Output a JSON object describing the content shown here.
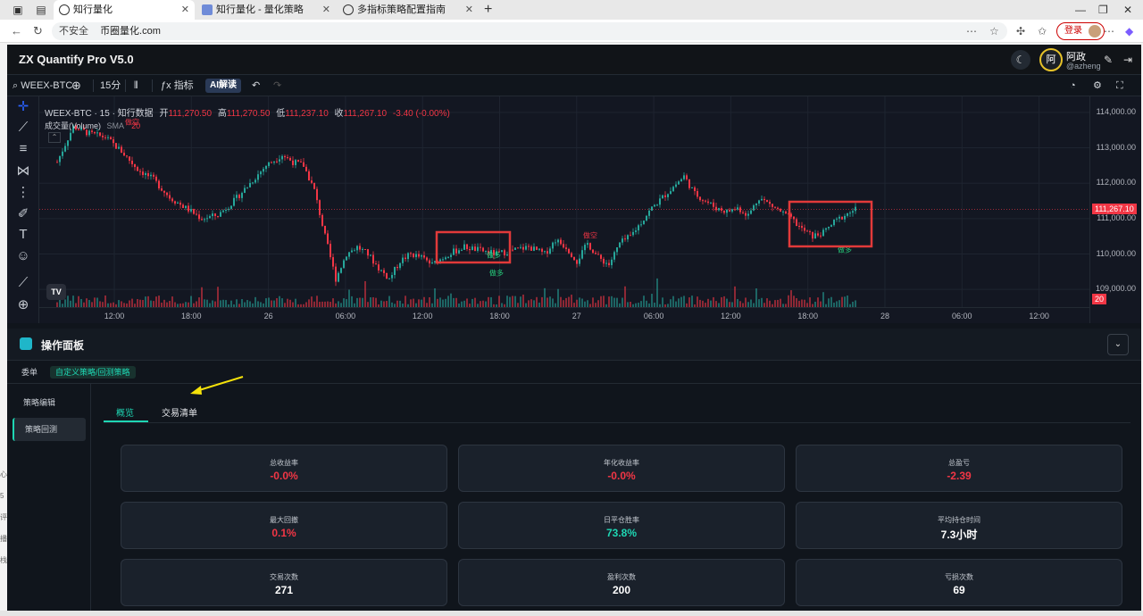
{
  "browser": {
    "tabs": [
      {
        "label": "知行量化",
        "active": true
      },
      {
        "label": "知行量化 - 量化策略",
        "active": false
      },
      {
        "label": "多指标策略配置指南",
        "active": false
      }
    ],
    "address": {
      "insecure_label": "不安全",
      "url": "币圈量化.com"
    },
    "login_label": "登录"
  },
  "app": {
    "title": "ZX Quantify Pro V5.0",
    "user": {
      "avatar_char": "阿",
      "name": "阿政",
      "handle": "@azheng"
    }
  },
  "toolbar": {
    "symbol": "WEEX-BTC",
    "interval": "15分",
    "indicators_label": "指标",
    "ai_label": "AI解读"
  },
  "chart_legend": {
    "title": "WEEX-BTC · 15 · 知行数据",
    "open_label": "开",
    "open": "111,270.50",
    "high_label": "高",
    "high": "111,270.50",
    "low_label": "低",
    "low": "111,237.10",
    "close_label": "收",
    "close": "111,267.10",
    "change": "-3.40 (-0.00%)",
    "volume_label": "成交量(Volume)",
    "sma_label": "SMA",
    "sma_value": "20"
  },
  "chart_data": {
    "type": "candlestick",
    "symbol": "WEEX-BTC",
    "interval": "15",
    "y_axis_ticks": [
      "114,000.00",
      "113,000.00",
      "112,000.00",
      "111,000.00",
      "110,000.00",
      "109,000.00"
    ],
    "ylim": [
      108500,
      114300
    ],
    "x_axis_ticks": [
      "12:00",
      "18:00",
      "26",
      "06:00",
      "12:00",
      "18:00",
      "27",
      "06:00",
      "12:00",
      "18:00",
      "28",
      "06:00",
      "12:00"
    ],
    "last_price": "111,267.10",
    "volume_sma_tag": "20",
    "signals": [
      {
        "label": "做空",
        "price": 113500,
        "type": "short"
      },
      {
        "label": "做多",
        "price": 109800,
        "type": "long"
      },
      {
        "label": "做空",
        "price": 110300,
        "type": "short"
      },
      {
        "label": "做多",
        "price": 110300,
        "type": "long"
      },
      {
        "label": "做多",
        "price": 110450,
        "type": "long"
      }
    ],
    "close_path": [
      [
        0,
        112600
      ],
      [
        6,
        113600
      ],
      [
        12,
        113400
      ],
      [
        18,
        113300
      ],
      [
        24,
        112900
      ],
      [
        30,
        112400
      ],
      [
        36,
        112100
      ],
      [
        42,
        111600
      ],
      [
        48,
        111300
      ],
      [
        54,
        111000
      ],
      [
        60,
        111100
      ],
      [
        66,
        111500
      ],
      [
        72,
        112000
      ],
      [
        78,
        112500
      ],
      [
        84,
        112800
      ],
      [
        88,
        112600
      ],
      [
        92,
        112500
      ],
      [
        96,
        111800
      ],
      [
        100,
        110500
      ],
      [
        104,
        109300
      ],
      [
        108,
        110000
      ],
      [
        112,
        110200
      ],
      [
        116,
        110000
      ],
      [
        120,
        109600
      ],
      [
        124,
        109300
      ],
      [
        128,
        109800
      ],
      [
        132,
        110000
      ],
      [
        136,
        109900
      ],
      [
        140,
        109700
      ],
      [
        146,
        110000
      ],
      [
        152,
        110200
      ],
      [
        158,
        110100
      ],
      [
        164,
        110000
      ],
      [
        170,
        110100
      ],
      [
        176,
        110200
      ],
      [
        182,
        110000
      ],
      [
        186,
        110400
      ],
      [
        190,
        110200
      ],
      [
        194,
        109800
      ],
      [
        198,
        110300
      ],
      [
        202,
        109900
      ],
      [
        206,
        109700
      ],
      [
        210,
        110300
      ],
      [
        214,
        110500
      ],
      [
        218,
        110900
      ],
      [
        222,
        111300
      ],
      [
        226,
        111600
      ],
      [
        230,
        111900
      ],
      [
        234,
        112200
      ],
      [
        238,
        111700
      ],
      [
        242,
        111500
      ],
      [
        246,
        111300
      ],
      [
        250,
        111200
      ],
      [
        254,
        111300
      ],
      [
        258,
        111100
      ],
      [
        262,
        111600
      ],
      [
        266,
        111400
      ],
      [
        270,
        111200
      ],
      [
        274,
        111000
      ],
      [
        278,
        110700
      ],
      [
        282,
        110500
      ],
      [
        286,
        110600
      ],
      [
        290,
        110900
      ],
      [
        294,
        111100
      ],
      [
        298,
        111267
      ]
    ]
  },
  "panel": {
    "title": "操作面板",
    "subtabs": [
      "委单",
      "自定义策略/回测策略"
    ],
    "sidenav": [
      "策略编辑",
      "策略回测"
    ],
    "content_tabs": [
      "概览",
      "交易清单"
    ],
    "stats": [
      {
        "label": "总收益率",
        "value": "-0.0%",
        "tone": "neg"
      },
      {
        "label": "年化收益率",
        "value": "-0.0%",
        "tone": "neg"
      },
      {
        "label": "总盈亏",
        "value": "-2.39",
        "tone": "neg"
      },
      {
        "label": "最大回撤",
        "value": "0.1%",
        "tone": "neg"
      },
      {
        "label": "日平仓胜率",
        "value": "73.8%",
        "tone": "pos"
      },
      {
        "label": "平均持仓时间",
        "value": "7.3小时",
        "tone": "plain"
      },
      {
        "label": "交易次数",
        "value": "271",
        "tone": "plain"
      },
      {
        "label": "盈利次数",
        "value": "200",
        "tone": "plain"
      },
      {
        "label": "亏损次数",
        "value": "69",
        "tone": "plain"
      }
    ]
  },
  "left_strip": [
    "心",
    "5",
    "评",
    "播",
    "栈"
  ],
  "colors": {
    "up": "#26a69a",
    "down": "#f23645",
    "accent": "#1ed6b3",
    "annotation": "#e23a3a",
    "arrow": "#f5e20a"
  }
}
